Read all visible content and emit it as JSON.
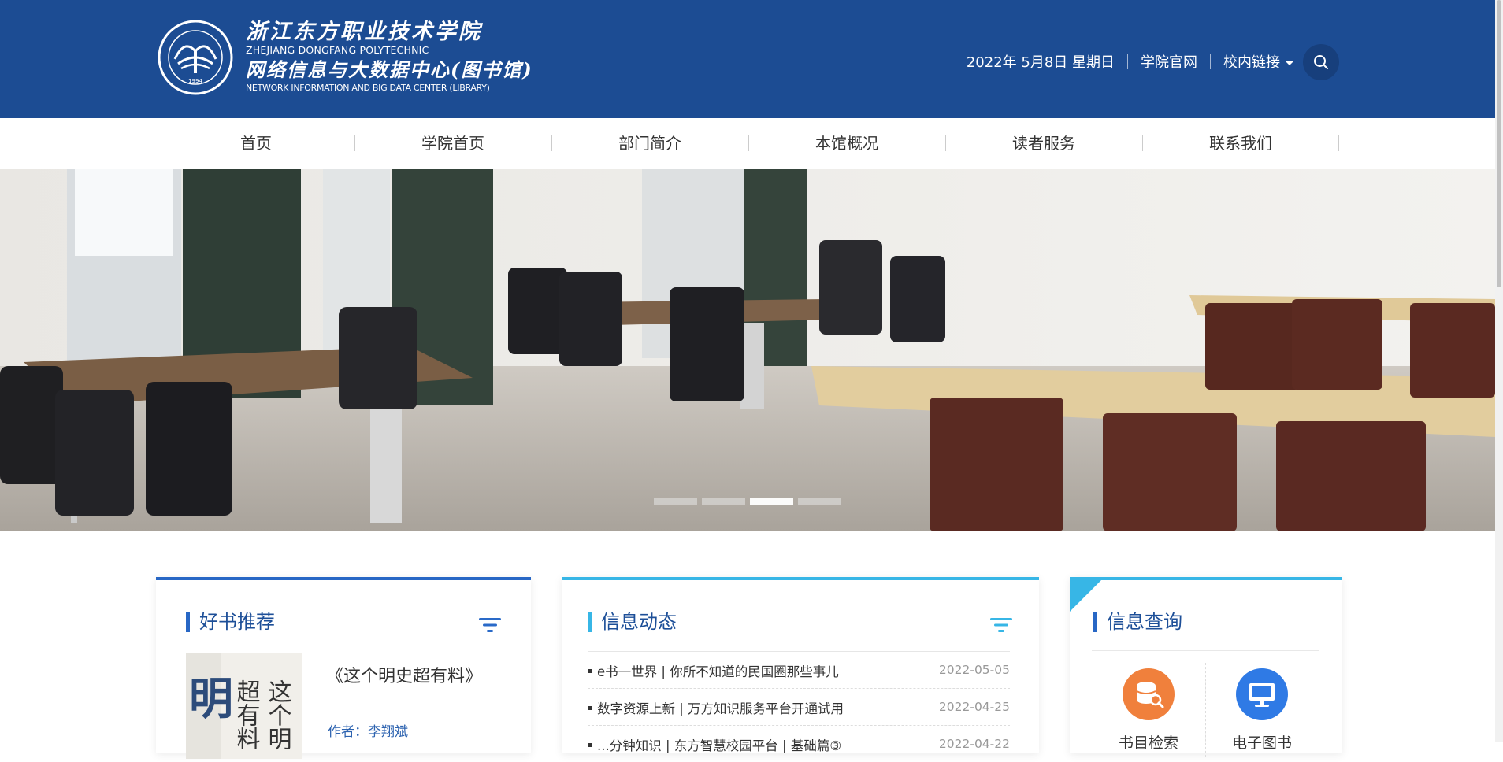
{
  "header": {
    "logo_title_cn": "浙江东方职业技术学院",
    "logo_title_en": "ZHEJIANG DONGFANG POLYTECHNIC",
    "logo_dept_cn": "网络信息与大数据中心(图书馆)",
    "logo_dept_en": "NETWORK INFORMATION AND BIG DATA CENTER (LIBRARY)",
    "seal_year": "1994",
    "date_text": "2022年 5月8日 星期日",
    "link_official": "学院官网",
    "link_campus": "校内链接",
    "colors": {
      "header_bg": "#1c4c93",
      "search_bg": "#173f7c"
    }
  },
  "nav": {
    "items": [
      {
        "label": "首页"
      },
      {
        "label": "学院首页"
      },
      {
        "label": "部门简介"
      },
      {
        "label": "本馆概况"
      },
      {
        "label": "读者服务"
      },
      {
        "label": "联系我们"
      }
    ]
  },
  "banner": {
    "slides_count": 4,
    "active_slide": 3
  },
  "books": {
    "title": "好书推荐",
    "book_title": "《这个明史超有料》",
    "author": "作者：李翔斌",
    "cover_text_col1": "这个明",
    "cover_text_col2": "超有料",
    "cover_big_char": "明"
  },
  "news": {
    "title": "信息动态",
    "items": [
      {
        "title": "e书一世界 | 你所不知道的民国圈那些事儿",
        "date": "2022-05-05"
      },
      {
        "title": "数字资源上新 | 万方知识服务平台开通试用",
        "date": "2022-04-25"
      },
      {
        "title": "...分钟知识 | 东方智慧校园平台 | 基础篇③",
        "date": "2022-04-22"
      }
    ]
  },
  "query": {
    "title": "信息查询",
    "items": [
      {
        "label": "书目检索",
        "icon": "database-search-icon",
        "color": "#f0803c"
      },
      {
        "label": "电子图书",
        "icon": "monitor-icon",
        "color": "#2f7ae5"
      }
    ]
  }
}
